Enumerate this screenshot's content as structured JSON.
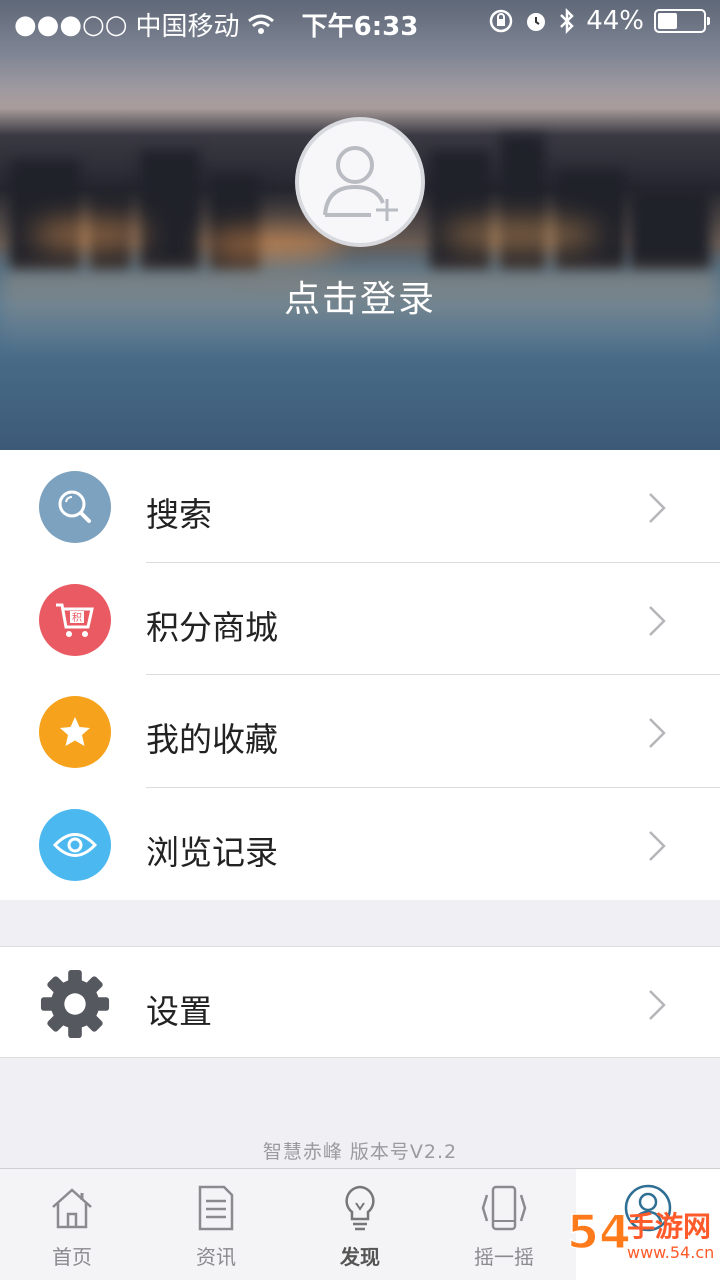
{
  "status_bar": {
    "signal": "●●●○○",
    "carrier": "中国移动",
    "time": "下午6:33",
    "battery_percent": "44%",
    "battery_level": 0.44
  },
  "profile": {
    "login_text": "点击登录"
  },
  "menu": {
    "items": [
      {
        "label": "搜索",
        "icon": "search-icon",
        "color": "#7da2bf"
      },
      {
        "label": "积分商城",
        "icon": "shopping-cart-icon",
        "color": "#ea5a63",
        "badge": "积"
      },
      {
        "label": "我的收藏",
        "icon": "star-icon",
        "color": "#f6a21c"
      },
      {
        "label": "浏览记录",
        "icon": "eye-icon",
        "color": "#4bb8ef"
      }
    ],
    "settings": {
      "label": "设置",
      "icon": "gear-icon",
      "color": "#55585f"
    }
  },
  "footer": {
    "version_text": "智慧赤峰  版本号V2.2"
  },
  "tabbar": {
    "tabs": [
      {
        "label": "首页",
        "icon": "home-icon"
      },
      {
        "label": "资讯",
        "icon": "document-icon"
      },
      {
        "label": "发现",
        "icon": "lightbulb-icon"
      },
      {
        "label": "摇一摇",
        "icon": "shake-phone-icon"
      },
      {
        "label": "",
        "icon": "user-icon"
      }
    ],
    "active_color": "#2f6f93"
  },
  "watermark": {
    "text": "54手游网 www.54.cn"
  }
}
